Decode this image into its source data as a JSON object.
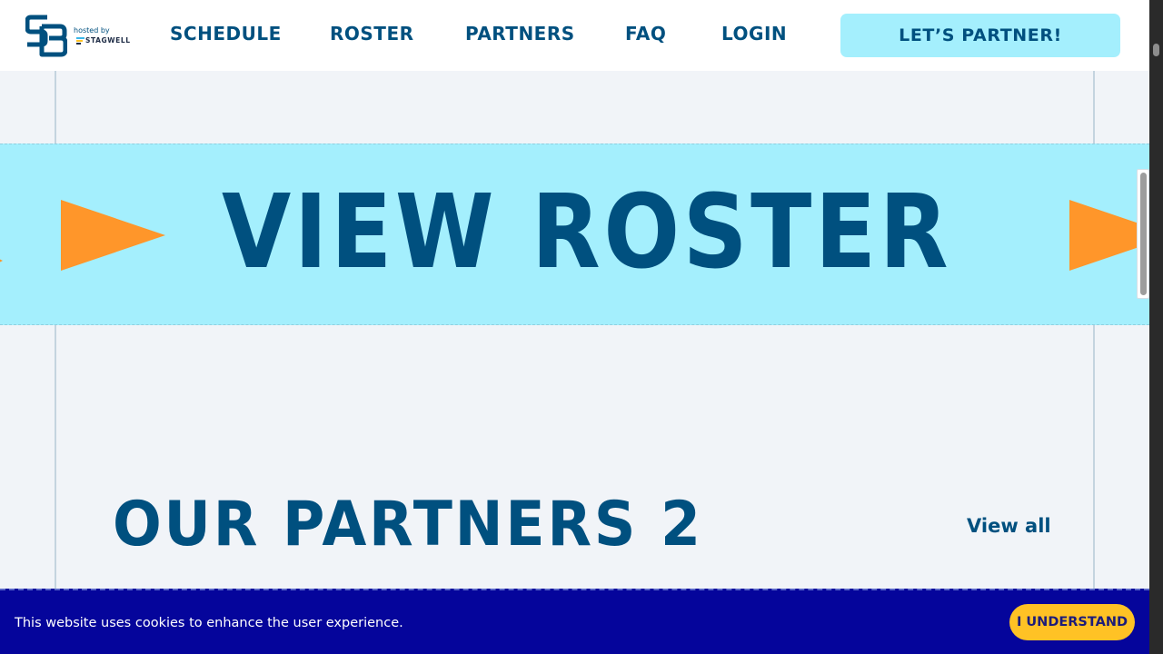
{
  "header": {
    "logo_alt": "SB",
    "hosted_by": "hosted by",
    "sponsor": "STAGWELL",
    "nav": [
      {
        "label": "SCHEDULE"
      },
      {
        "label": "ROSTER"
      },
      {
        "label": "PARTNERS"
      },
      {
        "label": "FAQ"
      },
      {
        "label": "LOGIN"
      }
    ],
    "cta_label": "LET’S PARTNER!"
  },
  "marquee": {
    "text": "VIEW ROSTER",
    "icon": "play-arrow-icon",
    "arrow_color": "#ff962a",
    "background": "#a4effd"
  },
  "partners_section": {
    "title": "OUR PARTNERS 2",
    "view_all_label": "View all"
  },
  "cookie_banner": {
    "message": "This website uses cookies to enhance the user experience.",
    "button_label": "I UNDERSTAND"
  },
  "colors": {
    "brand_navy": "#00507f",
    "light_cyan": "#a4effd",
    "orange": "#ff962a",
    "cookie_bg": "#05059b",
    "cookie_button": "#ffc225"
  }
}
